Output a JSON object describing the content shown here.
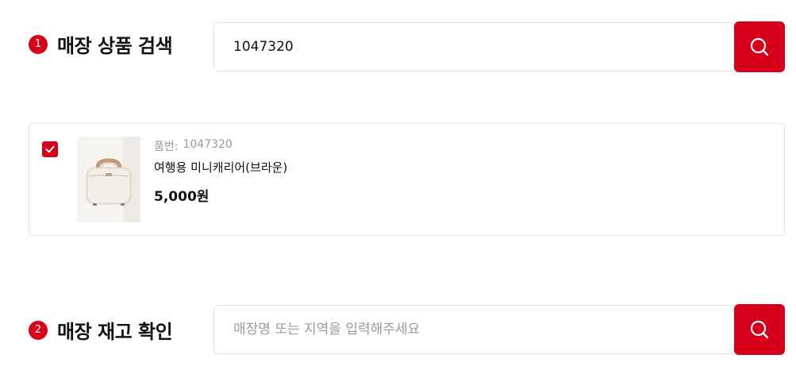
{
  "section1": {
    "step": "1",
    "title": "매장 상품 검색",
    "search_value": "1047320",
    "search_icon": "search-icon"
  },
  "product": {
    "checked": true,
    "sku_label": "품번:",
    "sku_value": "1047320",
    "name": "여행용 미니캐리어(브라운)",
    "price": "5,000원",
    "image": "mini-carrier-suitcase-image"
  },
  "section2": {
    "step": "2",
    "title": "매장 재고 확인",
    "search_placeholder": "매장명 또는 지역을 입력해주세요",
    "search_value": "",
    "search_icon": "search-icon"
  },
  "colors": {
    "accent": "#d7001a",
    "border": "#e2e2e2",
    "muted_text": "#9a9a9a"
  }
}
